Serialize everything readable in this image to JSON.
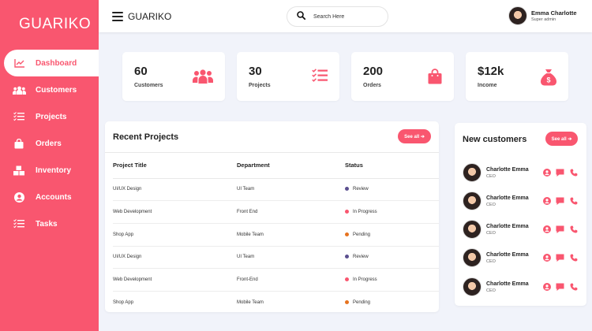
{
  "app": {
    "brand": "GUARIKO",
    "accent": "#f9566f"
  },
  "sidebar": {
    "items": [
      {
        "label": "Dashboard",
        "icon": "chart-line-icon",
        "active": true
      },
      {
        "label": "Customers",
        "icon": "users-icon"
      },
      {
        "label": "Projects",
        "icon": "tasks-list-icon"
      },
      {
        "label": "Orders",
        "icon": "shopping-bag-icon"
      },
      {
        "label": "Inventory",
        "icon": "boxes-icon"
      },
      {
        "label": "Accounts",
        "icon": "user-circle-icon"
      },
      {
        "label": "Tasks",
        "icon": "tasks-list-icon"
      }
    ]
  },
  "header": {
    "title": "GUARIKO",
    "search_placeholder": "Search Here",
    "user": {
      "name": "Emma Charlotte",
      "role": "Super admin"
    }
  },
  "stats": [
    {
      "value": "60",
      "label": "Customers",
      "icon": "users-icon"
    },
    {
      "value": "30",
      "label": "Projects",
      "icon": "tasks-list-icon"
    },
    {
      "value": "200",
      "label": "Orders",
      "icon": "shopping-bag-icon"
    },
    {
      "value": "$12k",
      "label": "Income",
      "icon": "money-bag-icon"
    }
  ],
  "recent_projects": {
    "title": "Recent Projects",
    "see_all": "See all ➔",
    "columns": [
      "Project Title",
      "Department",
      "Status"
    ],
    "rows": [
      {
        "title": "UI/UX Design",
        "dept": "UI Team",
        "status": "Review",
        "color": "#5b4f8f"
      },
      {
        "title": "Web Development",
        "dept": "Front End",
        "status": "In Progress",
        "color": "#f9566f"
      },
      {
        "title": "Shop App",
        "dept": "Mobile Team",
        "status": "Pending",
        "color": "#e6731f"
      },
      {
        "title": "UI/UX Design",
        "dept": "UI Team",
        "status": "Review",
        "color": "#5b4f8f"
      },
      {
        "title": "Web Development",
        "dept": "Front-End",
        "status": "In Progress",
        "color": "#f9566f"
      },
      {
        "title": "Shop App",
        "dept": "Mobile Team",
        "status": "Pending",
        "color": "#e6731f"
      }
    ]
  },
  "new_customers": {
    "title": "New customers",
    "see_all": "See all ➔",
    "rows": [
      {
        "name": "Charlotte Emma",
        "role": "CEO"
      },
      {
        "name": "Charlotte Emma",
        "role": "CEO"
      },
      {
        "name": "Charlotte Emma",
        "role": "CEO"
      },
      {
        "name": "Charlotte Emma",
        "role": "CEO"
      },
      {
        "name": "Charlotte Emma",
        "role": "CEO"
      }
    ]
  }
}
